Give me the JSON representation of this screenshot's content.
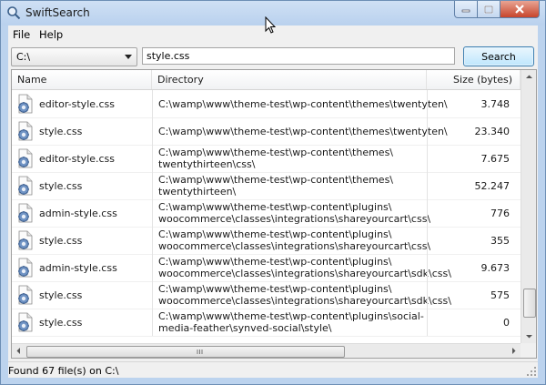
{
  "window": {
    "title": "SwiftSearch"
  },
  "menu": [
    {
      "label": "File"
    },
    {
      "label": "Help"
    }
  ],
  "toolbar": {
    "drive": "C:\\",
    "query": "style.css",
    "search_label": "Search"
  },
  "columns": {
    "name": "Name",
    "directory": "Directory",
    "size": "Size (bytes)"
  },
  "rows": [
    {
      "name": "editor-style.css",
      "dir1": "C:\\wamp\\www\\theme-test\\wp-content\\themes\\twentyten\\",
      "dir2": "",
      "size": "3.748"
    },
    {
      "name": "style.css",
      "dir1": "C:\\wamp\\www\\theme-test\\wp-content\\themes\\twentyten\\",
      "dir2": "",
      "size": "23.340"
    },
    {
      "name": "editor-style.css",
      "dir1": "C:\\wamp\\www\\theme-test\\wp-content\\themes\\",
      "dir2": "twentythirteen\\css\\",
      "size": "7.675"
    },
    {
      "name": "style.css",
      "dir1": "C:\\wamp\\www\\theme-test\\wp-content\\themes\\",
      "dir2": "twentythirteen\\",
      "size": "52.247"
    },
    {
      "name": "admin-style.css",
      "dir1": "C:\\wamp\\www\\theme-test\\wp-content\\plugins\\",
      "dir2": "woocommerce\\classes\\integrations\\shareyourcart\\css\\",
      "size": "776"
    },
    {
      "name": "style.css",
      "dir1": "C:\\wamp\\www\\theme-test\\wp-content\\plugins\\",
      "dir2": "woocommerce\\classes\\integrations\\shareyourcart\\css\\",
      "size": "355"
    },
    {
      "name": "admin-style.css",
      "dir1": "C:\\wamp\\www\\theme-test\\wp-content\\plugins\\",
      "dir2": "woocommerce\\classes\\integrations\\shareyourcart\\sdk\\css\\",
      "size": "9.673"
    },
    {
      "name": "style.css",
      "dir1": "C:\\wamp\\www\\theme-test\\wp-content\\plugins\\",
      "dir2": "woocommerce\\classes\\integrations\\shareyourcart\\sdk\\css\\",
      "size": "575"
    },
    {
      "name": "style.css",
      "dir1": "C:\\wamp\\www\\theme-test\\wp-content\\plugins\\social-",
      "dir2": "media-feather\\synved-social\\style\\",
      "size": "0"
    }
  ],
  "status": {
    "text": "Found 67 file(s) on C:\\"
  },
  "icons": {
    "file": "css-file-icon",
    "app": "search-app-icon"
  }
}
